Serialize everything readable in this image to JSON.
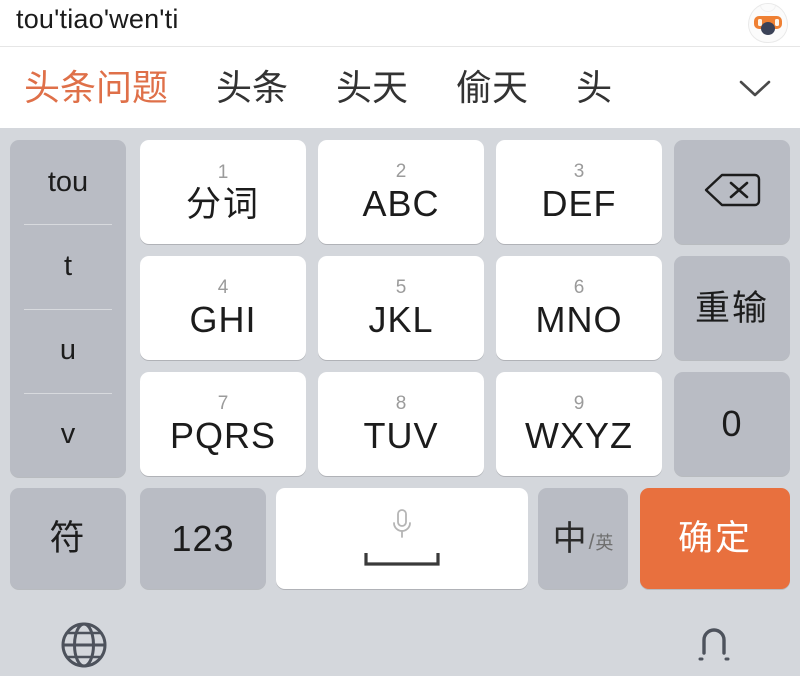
{
  "compose": {
    "pinyin": "tou'tiao'wen'ti",
    "avatar_icon": "ime-mascot-avatar-icon"
  },
  "candidates": {
    "expand_icon": "chevron-down-icon",
    "items": [
      {
        "text": "头条问题",
        "selected": true
      },
      {
        "text": "头条",
        "selected": false
      },
      {
        "text": "头天",
        "selected": false
      },
      {
        "text": "偷天",
        "selected": false
      },
      {
        "text": "头",
        "selected": false
      }
    ]
  },
  "keyboard": {
    "pinyin_column": [
      "tou",
      "t",
      "u",
      "v"
    ],
    "keys": [
      {
        "num": "1",
        "label": "分词",
        "style": "white",
        "cjk": true
      },
      {
        "num": "2",
        "label": "ABC",
        "style": "white",
        "cjk": false
      },
      {
        "num": "3",
        "label": "DEF",
        "style": "white",
        "cjk": false
      },
      {
        "num": "4",
        "label": "GHI",
        "style": "white",
        "cjk": false
      },
      {
        "num": "5",
        "label": "JKL",
        "style": "white",
        "cjk": false
      },
      {
        "num": "6",
        "label": "MNO",
        "style": "white",
        "cjk": false
      },
      {
        "num": "7",
        "label": "PQRS",
        "style": "white",
        "cjk": false
      },
      {
        "num": "8",
        "label": "TUV",
        "style": "white",
        "cjk": false
      },
      {
        "num": "9",
        "label": "WXYZ",
        "style": "white",
        "cjk": false
      }
    ],
    "backspace": {
      "icon": "backspace-icon"
    },
    "redo": {
      "label": "重输"
    },
    "zero": {
      "label": "0"
    },
    "symbols": {
      "label": "符"
    },
    "numbers": {
      "label": "123"
    },
    "space": {
      "mic_icon": "microphone-icon",
      "space_icon": "spacebar-icon"
    },
    "lang_toggle": {
      "primary": "中",
      "separator": "/",
      "secondary": "英"
    },
    "confirm": {
      "label": "确定"
    }
  },
  "bottom_bar": {
    "globe_icon": "globe-icon",
    "hide_keyboard_icon": "hide-keyboard-icon"
  },
  "colors": {
    "accent": "#e8703e",
    "selected_candidate": "#df7049",
    "keyboard_bg": "#d4d7dc",
    "gray_key": "#b9bcc4",
    "white_key": "#ffffff"
  }
}
